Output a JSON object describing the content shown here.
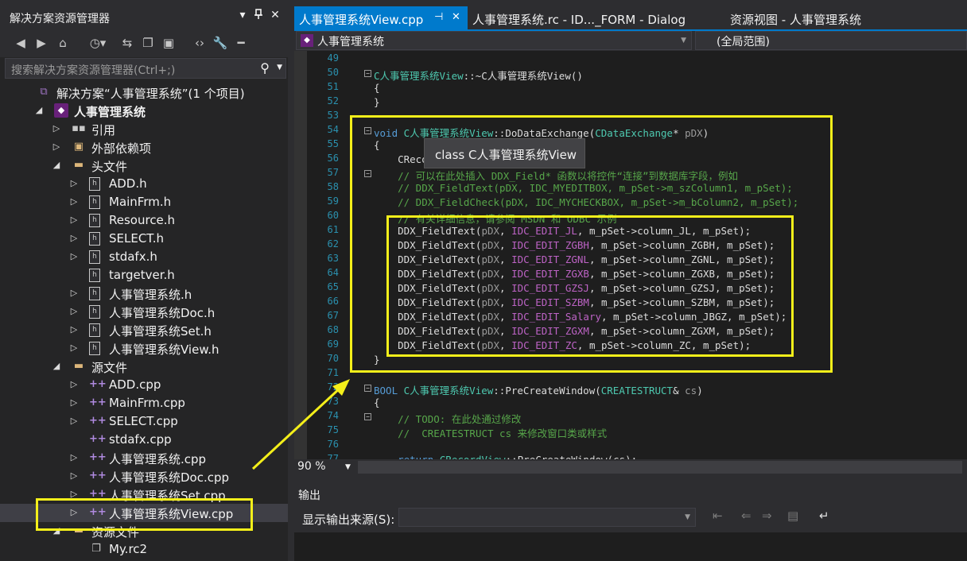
{
  "solution_explorer": {
    "title": "解决方案资源管理器",
    "controls": {
      "dropdown": "▾",
      "pin": "⊥",
      "close": "✕"
    },
    "search_placeholder": "搜索解决方案资源管理器(Ctrl+;)",
    "toolbar_icons": [
      "back-icon",
      "forward-icon",
      "home-icon",
      "history-icon",
      "sync-icon",
      "collapse-icon",
      "properties-icon",
      "code-view-icon",
      "wrench-icon",
      "minus-icon"
    ],
    "tree": [
      {
        "label": "解决方案“人事管理系统”(1 个项目)",
        "icon": "solution-icon",
        "indent": 0,
        "arrow": ""
      },
      {
        "label": "人事管理系统",
        "icon": "project-icon",
        "indent": 1,
        "arrow": "expanded",
        "bold": true
      },
      {
        "label": "引用",
        "icon": "references-icon",
        "indent": 2,
        "arrow": "collapsed"
      },
      {
        "label": "外部依赖项",
        "icon": "external-deps-icon",
        "indent": 2,
        "arrow": "collapsed"
      },
      {
        "label": "头文件",
        "icon": "folder-icon",
        "indent": 2,
        "arrow": "expanded"
      },
      {
        "label": "ADD.h",
        "icon": "header-file-icon",
        "indent": 3,
        "arrow": "collapsed"
      },
      {
        "label": "MainFrm.h",
        "icon": "header-file-icon",
        "indent": 3,
        "arrow": "collapsed"
      },
      {
        "label": "Resource.h",
        "icon": "header-file-icon",
        "indent": 3,
        "arrow": "collapsed"
      },
      {
        "label": "SELECT.h",
        "icon": "header-file-icon",
        "indent": 3,
        "arrow": "collapsed"
      },
      {
        "label": "stdafx.h",
        "icon": "header-file-icon",
        "indent": 3,
        "arrow": "collapsed"
      },
      {
        "label": "targetver.h",
        "icon": "header-file-icon",
        "indent": 3,
        "arrow": ""
      },
      {
        "label": "人事管理系统.h",
        "icon": "header-file-icon",
        "indent": 3,
        "arrow": "collapsed"
      },
      {
        "label": "人事管理系统Doc.h",
        "icon": "header-file-icon",
        "indent": 3,
        "arrow": "collapsed"
      },
      {
        "label": "人事管理系统Set.h",
        "icon": "header-file-icon",
        "indent": 3,
        "arrow": "collapsed"
      },
      {
        "label": "人事管理系统View.h",
        "icon": "header-file-icon",
        "indent": 3,
        "arrow": "collapsed"
      },
      {
        "label": "源文件",
        "icon": "folder-icon",
        "indent": 2,
        "arrow": "expanded"
      },
      {
        "label": "ADD.cpp",
        "icon": "cpp-file-icon",
        "indent": 3,
        "arrow": "collapsed"
      },
      {
        "label": "MainFrm.cpp",
        "icon": "cpp-file-icon",
        "indent": 3,
        "arrow": "collapsed"
      },
      {
        "label": "SELECT.cpp",
        "icon": "cpp-file-icon",
        "indent": 3,
        "arrow": "collapsed"
      },
      {
        "label": "stdafx.cpp",
        "icon": "cpp-file-icon",
        "indent": 3,
        "arrow": ""
      },
      {
        "label": "人事管理系统.cpp",
        "icon": "cpp-file-icon",
        "indent": 3,
        "arrow": "collapsed"
      },
      {
        "label": "人事管理系统Doc.cpp",
        "icon": "cpp-file-icon",
        "indent": 3,
        "arrow": "collapsed"
      },
      {
        "label": "人事管理系统Set.cpp",
        "icon": "cpp-file-icon",
        "indent": 3,
        "arrow": "collapsed"
      },
      {
        "label": "人事管理系统View.cpp",
        "icon": "cpp-file-icon",
        "indent": 3,
        "arrow": "collapsed",
        "selected": true
      },
      {
        "label": "资源文件",
        "icon": "folder-icon",
        "indent": 2,
        "arrow": "expanded"
      },
      {
        "label": "My.rc2",
        "icon": "rc-file-icon",
        "indent": 3,
        "arrow": ""
      }
    ]
  },
  "tabs": [
    {
      "label": "人事管理系统View.cpp",
      "active": true,
      "pin": "⊣",
      "close": "✕"
    },
    {
      "label": "人事管理系统.rc - ID..._FORM - Dialog",
      "active": false
    },
    {
      "label": "资源视图 - 人事管理系统",
      "active": false
    }
  ],
  "navbar": {
    "class_combo": "人事管理系统",
    "scope_combo": "(全局范围)"
  },
  "code_lines": [
    {
      "n": "49",
      "code": "",
      "fold": ""
    },
    {
      "n": "50",
      "code": "<span class=\"ty\">C人事管理系统View</span>::~C人事管理系统View()",
      "fold": "-"
    },
    {
      "n": "51",
      "code": "{",
      "fold": ""
    },
    {
      "n": "52",
      "code": "}",
      "fold": ""
    },
    {
      "n": "53",
      "code": "",
      "fold": ""
    },
    {
      "n": "54",
      "code": "<span class=\"kw\">void</span> <span class=\"ty\">C人事管理系统View</span>::DoDataExchange(<span class=\"ty\">CDataExchange</span>* <span class=\"pm\">pDX</span>)",
      "fold": "-"
    },
    {
      "n": "55",
      "code": "{",
      "fold": ""
    },
    {
      "n": "56",
      "code": "    CReco",
      "fold": ""
    },
    {
      "n": "57",
      "code": "    <span class=\"cm\">// 可以在此处插入 DDX_Field* 函数以将控件“连接”到数据库字段，例如</span>",
      "fold": "-"
    },
    {
      "n": "58",
      "code": "    <span class=\"cm\">// DDX_FieldText(pDX, IDC_MYEDITBOX, m_pSet->m_szColumn1, m_pSet);</span>",
      "fold": ""
    },
    {
      "n": "59",
      "code": "    <span class=\"cm\">// DDX_FieldCheck(pDX, IDC_MYCHECKBOX, m_pSet->m_bColumn2, m_pSet);</span>",
      "fold": ""
    },
    {
      "n": "60",
      "code": "    <span class=\"cm\">// 有关详细信息，请参阅 MSDN 和 ODBC 示例</span>",
      "fold": ""
    },
    {
      "n": "61",
      "code": "    DDX_FieldText(<span class=\"pm\">pDX</span>, <span class=\"mc\">IDC_EDIT_JL</span>, m_pSet->column_JL, m_pSet);",
      "fold": ""
    },
    {
      "n": "62",
      "code": "    DDX_FieldText(<span class=\"pm\">pDX</span>, <span class=\"mc\">IDC_EDIT_ZGBH</span>, m_pSet->column_ZGBH, m_pSet);",
      "fold": ""
    },
    {
      "n": "63",
      "code": "    DDX_FieldText(<span class=\"pm\">pDX</span>, <span class=\"mc\">IDC_EDIT_ZGNL</span>, m_pSet->column_ZGNL, m_pSet);",
      "fold": ""
    },
    {
      "n": "64",
      "code": "    DDX_FieldText(<span class=\"pm\">pDX</span>, <span class=\"mc\">IDC_EDIT_ZGXB</span>, m_pSet->column_ZGXB, m_pSet);",
      "fold": ""
    },
    {
      "n": "65",
      "code": "    DDX_FieldText(<span class=\"pm\">pDX</span>, <span class=\"mc\">IDC_EDIT_GZSJ</span>, m_pSet->column_GZSJ, m_pSet);",
      "fold": ""
    },
    {
      "n": "66",
      "code": "    DDX_FieldText(<span class=\"pm\">pDX</span>, <span class=\"mc\">IDC_EDIT_SZBM</span>, m_pSet->column_SZBM, m_pSet);",
      "fold": ""
    },
    {
      "n": "67",
      "code": "    DDX_FieldText(<span class=\"pm\">pDX</span>, <span class=\"mc\">IDC_EDIT_Salary</span>, m_pSet->column_JBGZ, m_pSet);",
      "fold": ""
    },
    {
      "n": "68",
      "code": "    DDX_FieldText(<span class=\"pm\">pDX</span>, <span class=\"mc\">IDC_EDIT_ZGXM</span>, m_pSet->column_ZGXM, m_pSet);",
      "fold": ""
    },
    {
      "n": "69",
      "code": "    DDX_FieldText(<span class=\"pm\">pDX</span>, <span class=\"mc\">IDC_EDIT_ZC</span>, m_pSet->column_ZC, m_pSet);",
      "fold": ""
    },
    {
      "n": "70",
      "code": "}",
      "fold": ""
    },
    {
      "n": "71",
      "code": "",
      "fold": ""
    },
    {
      "n": "72",
      "code": "<span class=\"kw\">BOOL</span> <span class=\"ty\">C人事管理系统View</span>::PreCreateWindow(<span class=\"ty\">CREATESTRUCT</span>&amp; <span class=\"pm\">cs</span>)",
      "fold": "-"
    },
    {
      "n": "73",
      "code": "{",
      "fold": ""
    },
    {
      "n": "74",
      "code": "    <span class=\"cm\">// TODO: 在此处通过修改</span>",
      "fold": "-"
    },
    {
      "n": "75",
      "code": "    <span class=\"cm\">//  CREATESTRUCT cs 来修改窗口类或样式</span>",
      "fold": ""
    },
    {
      "n": "76",
      "code": "",
      "fold": ""
    },
    {
      "n": "77",
      "code": "    <span class=\"kw\">return</span> <span class=\"ty\">CRecordView</span>::PreCreateWindow(cs);",
      "fold": ""
    }
  ],
  "tooltip": "class C人事管理系统View",
  "zoom": "90 %",
  "output": {
    "title": "输出",
    "source_label": "显示输出来源(S):",
    "source_value": ""
  }
}
